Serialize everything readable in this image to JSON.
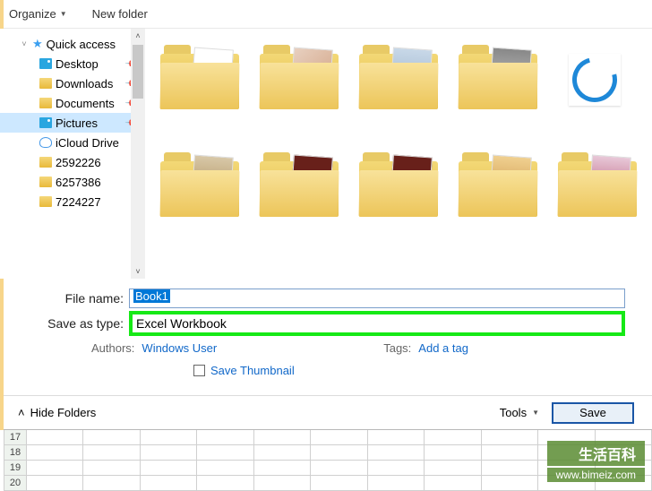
{
  "toolbar": {
    "organize": "Organize",
    "new_folder": "New folder"
  },
  "sidebar": {
    "quick_access": "Quick access",
    "items": [
      {
        "label": "Desktop",
        "icon": "desktop"
      },
      {
        "label": "Downloads",
        "icon": "downloads"
      },
      {
        "label": "Documents",
        "icon": "documents"
      },
      {
        "label": "Pictures",
        "icon": "pictures",
        "selected": true
      },
      {
        "label": "iCloud Drive",
        "icon": "cloud"
      },
      {
        "label": "2592226",
        "icon": "folder"
      },
      {
        "label": "6257386",
        "icon": "folder"
      },
      {
        "label": "7224227",
        "icon": "folder"
      }
    ]
  },
  "form": {
    "file_name_label": "File name:",
    "file_name_value": "Book1",
    "save_type_label": "Save as type:",
    "save_type_value": "Excel Workbook",
    "authors_label": "Authors:",
    "authors_value": "Windows User",
    "tags_label": "Tags:",
    "tags_value": "Add a tag",
    "save_thumbnail": "Save Thumbnail"
  },
  "actions": {
    "hide_folders": "Hide Folders",
    "tools": "Tools",
    "save": "Save"
  },
  "spreadsheet": {
    "rows": [
      "17",
      "18",
      "19",
      "20"
    ]
  },
  "watermark": {
    "title": "生活百科",
    "url": "www.bimeiz.com"
  }
}
